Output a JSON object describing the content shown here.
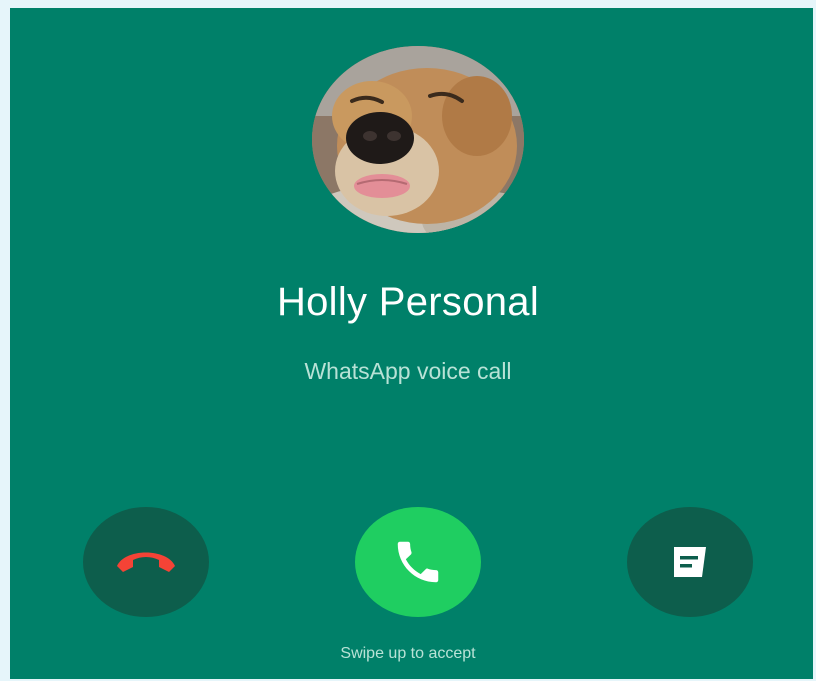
{
  "call": {
    "caller_name": "Holly Personal",
    "call_type": "WhatsApp voice call",
    "swipe_hint": "Swipe up to accept"
  },
  "actions": [
    {
      "name": "decline",
      "icon": "hang-up-icon",
      "color": "#f44336"
    },
    {
      "name": "accept",
      "icon": "phone-icon",
      "color": "#ffffff"
    },
    {
      "name": "message",
      "icon": "message-icon",
      "color": "#ffffff"
    }
  ],
  "colors": {
    "background": "#008069",
    "accept": "#1fce61",
    "secondary_button": "#0d5e4c",
    "decline_icon": "#f44336"
  }
}
